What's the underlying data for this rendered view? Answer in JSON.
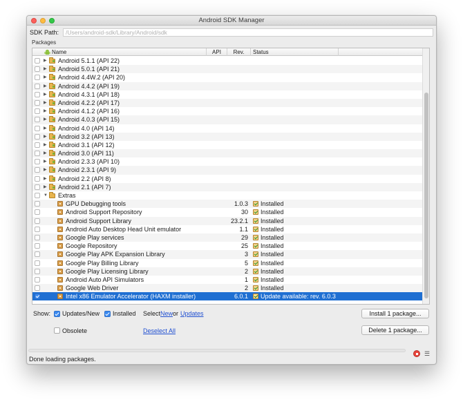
{
  "window": {
    "title": "Android SDK Manager"
  },
  "sdk_path": {
    "label": "SDK Path:",
    "value": "/Users/android-sdk/Library/Android/sdk"
  },
  "packages_label": "Packages",
  "columns": {
    "name": "Name",
    "api": "API",
    "rev": "Rev.",
    "status": "Status"
  },
  "rows": [
    {
      "type": "api",
      "name": "Android 5.1.1 (API 22)",
      "api": "",
      "rev": "",
      "status": "",
      "checked": false
    },
    {
      "type": "api",
      "name": "Android 5.0.1 (API 21)",
      "api": "",
      "rev": "",
      "status": "",
      "checked": false
    },
    {
      "type": "api",
      "name": "Android 4.4W.2 (API 20)",
      "api": "",
      "rev": "",
      "status": "",
      "checked": false
    },
    {
      "type": "api",
      "name": "Android 4.4.2 (API 19)",
      "api": "",
      "rev": "",
      "status": "",
      "checked": false
    },
    {
      "type": "api",
      "name": "Android 4.3.1 (API 18)",
      "api": "",
      "rev": "",
      "status": "",
      "checked": false
    },
    {
      "type": "api",
      "name": "Android 4.2.2 (API 17)",
      "api": "",
      "rev": "",
      "status": "",
      "checked": false
    },
    {
      "type": "api",
      "name": "Android 4.1.2 (API 16)",
      "api": "",
      "rev": "",
      "status": "",
      "checked": false
    },
    {
      "type": "api",
      "name": "Android 4.0.3 (API 15)",
      "api": "",
      "rev": "",
      "status": "",
      "checked": false
    },
    {
      "type": "api",
      "name": "Android 4.0 (API 14)",
      "api": "",
      "rev": "",
      "status": "",
      "checked": false
    },
    {
      "type": "api",
      "name": "Android 3.2 (API 13)",
      "api": "",
      "rev": "",
      "status": "",
      "checked": false
    },
    {
      "type": "api",
      "name": "Android 3.1 (API 12)",
      "api": "",
      "rev": "",
      "status": "",
      "checked": false
    },
    {
      "type": "api",
      "name": "Android 3.0 (API 11)",
      "api": "",
      "rev": "",
      "status": "",
      "checked": false
    },
    {
      "type": "api",
      "name": "Android 2.3.3 (API 10)",
      "api": "",
      "rev": "",
      "status": "",
      "checked": false
    },
    {
      "type": "api",
      "name": "Android 2.3.1 (API 9)",
      "api": "",
      "rev": "",
      "status": "",
      "checked": false
    },
    {
      "type": "api",
      "name": "Android 2.2 (API 8)",
      "api": "",
      "rev": "",
      "status": "",
      "checked": false
    },
    {
      "type": "api",
      "name": "Android 2.1 (API 7)",
      "api": "",
      "rev": "",
      "status": "",
      "checked": false
    },
    {
      "type": "folder",
      "name": "Extras",
      "api": "",
      "rev": "",
      "status": "",
      "checked": false
    },
    {
      "type": "pkg",
      "name": "GPU Debugging tools",
      "api": "",
      "rev": "1.0.3",
      "status": "Installed",
      "checked": false
    },
    {
      "type": "pkg",
      "name": "Android Support Repository",
      "api": "",
      "rev": "30",
      "status": "Installed",
      "checked": false
    },
    {
      "type": "pkg",
      "name": "Android Support Library",
      "api": "",
      "rev": "23.2.1",
      "status": "Installed",
      "checked": false
    },
    {
      "type": "pkg",
      "name": "Android Auto Desktop Head Unit emulator",
      "api": "",
      "rev": "1.1",
      "status": "Installed",
      "checked": false
    },
    {
      "type": "pkg",
      "name": "Google Play services",
      "api": "",
      "rev": "29",
      "status": "Installed",
      "checked": false
    },
    {
      "type": "pkg",
      "name": "Google Repository",
      "api": "",
      "rev": "25",
      "status": "Installed",
      "checked": false
    },
    {
      "type": "pkg",
      "name": "Google Play APK Expansion Library",
      "api": "",
      "rev": "3",
      "status": "Installed",
      "checked": false
    },
    {
      "type": "pkg",
      "name": "Google Play Billing Library",
      "api": "",
      "rev": "5",
      "status": "Installed",
      "checked": false
    },
    {
      "type": "pkg",
      "name": "Google Play Licensing Library",
      "api": "",
      "rev": "2",
      "status": "Installed",
      "checked": false
    },
    {
      "type": "pkg",
      "name": "Android Auto API Simulators",
      "api": "",
      "rev": "1",
      "status": "Installed",
      "checked": false
    },
    {
      "type": "pkg",
      "name": "Google Web Driver",
      "api": "",
      "rev": "2",
      "status": "Installed",
      "checked": false
    },
    {
      "type": "pkg",
      "name": "Intel x86 Emulator Accelerator (HAXM installer)",
      "api": "",
      "rev": "6.0.1",
      "status": "Update available: rev. 6.0.3",
      "checked": true,
      "selected": true,
      "update": true
    }
  ],
  "filters": {
    "show_label": "Show:",
    "updates_new": "Updates/New",
    "installed": "Installed",
    "obsolete": "Obsolete",
    "select_prefix": "Select",
    "select_new": "New",
    "select_or": "or",
    "select_updates": "Updates",
    "deselect_all": "Deselect All"
  },
  "buttons": {
    "install": "Install 1 package...",
    "delete": "Delete 1 package..."
  },
  "status_bar": {
    "text": "Done loading packages."
  },
  "colors": {
    "selection": "#1f6fd2",
    "link": "#1f4fd1",
    "checkbox_on": "#3b8af0"
  }
}
